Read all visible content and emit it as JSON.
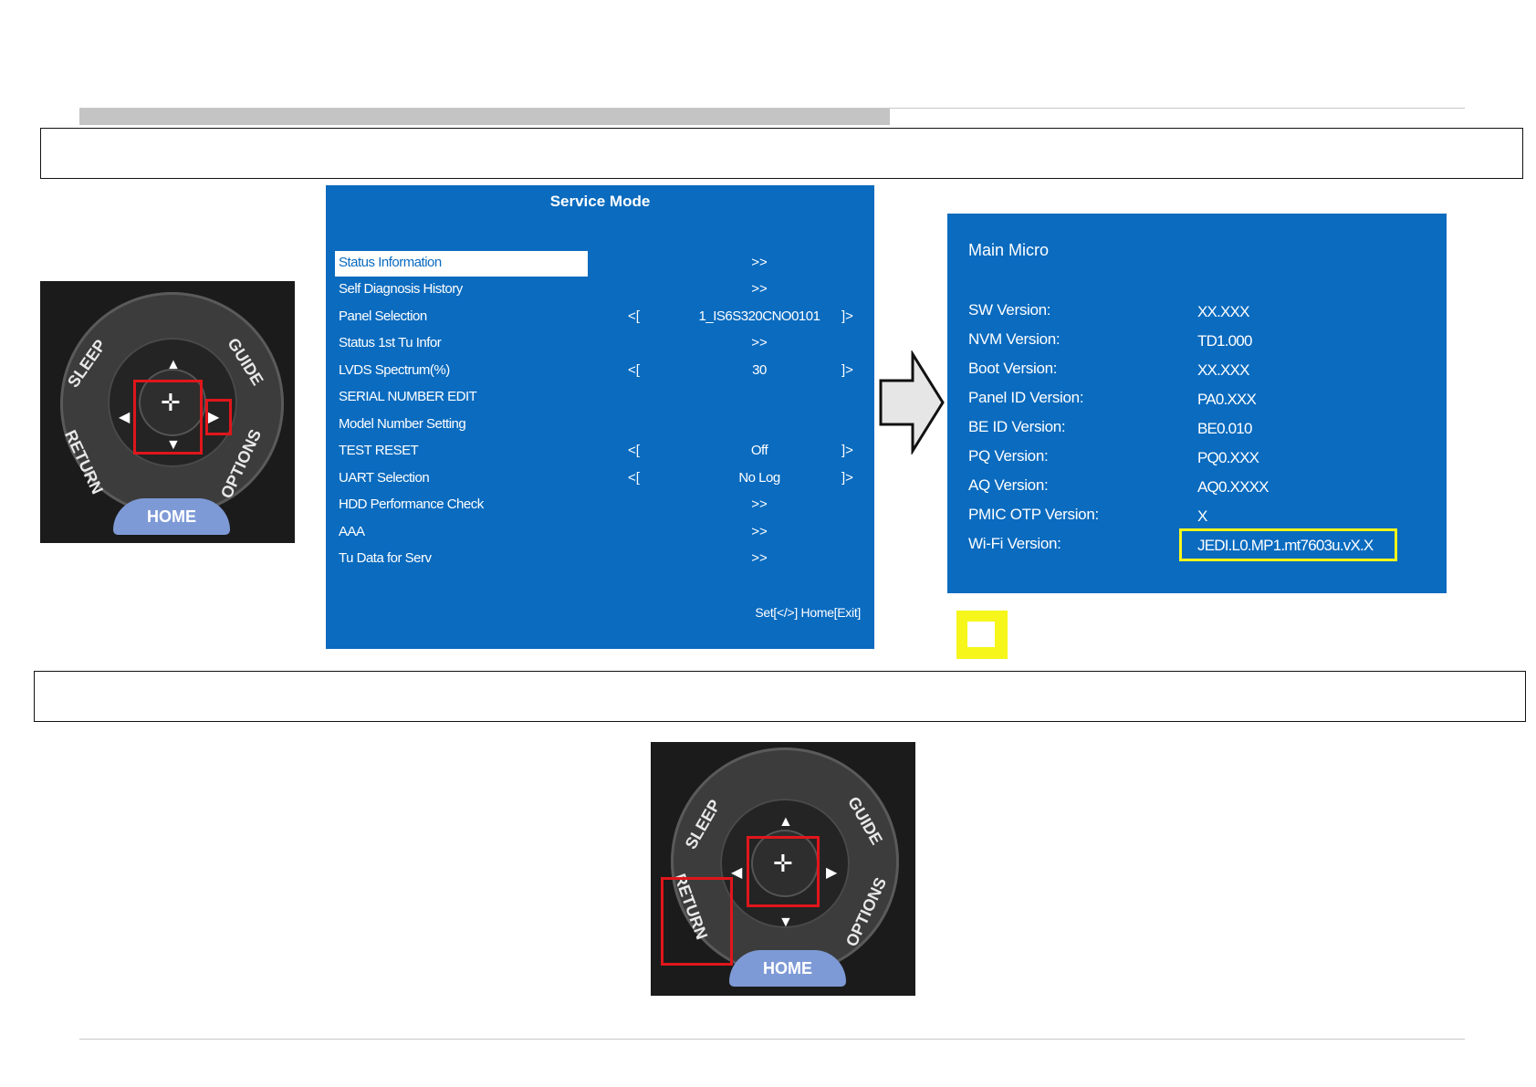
{
  "service_mode": {
    "title": "Service Mode",
    "items": [
      {
        "label": "Status Information",
        "type": "chev",
        "chev": ">>",
        "selected": true
      },
      {
        "label": "Self Diagnosis History",
        "type": "chev",
        "chev": ">>"
      },
      {
        "label": "Panel Selection",
        "type": "value",
        "left": "<[",
        "value": "1_IS6S320CNO0101",
        "right": "]>"
      },
      {
        "label": "Status 1st Tu Infor",
        "type": "chev",
        "chev": ">>"
      },
      {
        "label": "LVDS Spectrum(%)",
        "type": "value",
        "left": "<[",
        "value": "30",
        "right": "]>"
      },
      {
        "label": "SERIAL NUMBER EDIT",
        "type": "none"
      },
      {
        "label": "Model Number Setting",
        "type": "none"
      },
      {
        "label": "TEST RESET",
        "type": "value",
        "left": "<[",
        "value": "Off",
        "right": "]>"
      },
      {
        "label": "UART Selection",
        "type": "value",
        "left": "<[",
        "value": "No Log",
        "right": "]>"
      },
      {
        "label": "HDD Performance Check",
        "type": "chev",
        "chev": ">>"
      },
      {
        "label": "AAA",
        "type": "chev",
        "chev": ">>"
      },
      {
        "label": "Tu Data for Serv",
        "type": "chev",
        "chev": ">>"
      }
    ],
    "footer": "Set[</>] Home[Exit]"
  },
  "main_micro": {
    "title": "Main Micro",
    "rows": [
      {
        "key": "SW Version:",
        "value": "XX.XXX"
      },
      {
        "key": "NVM Version:",
        "value": "TD1.000"
      },
      {
        "key": "Boot Version:",
        "value": "XX.XXX"
      },
      {
        "key": "Panel ID Version:",
        "value": "PA0.XXX"
      },
      {
        "key": "BE ID Version:",
        "value": "BE0.010"
      },
      {
        "key": "PQ Version:",
        "value": "PQ0.XXX"
      },
      {
        "key": "AQ Version:",
        "value": "AQ0.XXXX"
      },
      {
        "key": "PMIC OTP Version:",
        "value": "X"
      },
      {
        "key": "Wi-Fi Version:",
        "value": "JEDI.L0.MP1.mt7603u.vX.X"
      }
    ]
  },
  "remote": {
    "sleep": "SLEEP",
    "guide": "GUIDE",
    "return": "RETURN",
    "options": "OPTIONS",
    "home": "HOME"
  },
  "colors": {
    "panel_blue": "#0a6bbf",
    "highlight_red": "#e0161b",
    "highlight_yellow": "#f6f61a"
  }
}
